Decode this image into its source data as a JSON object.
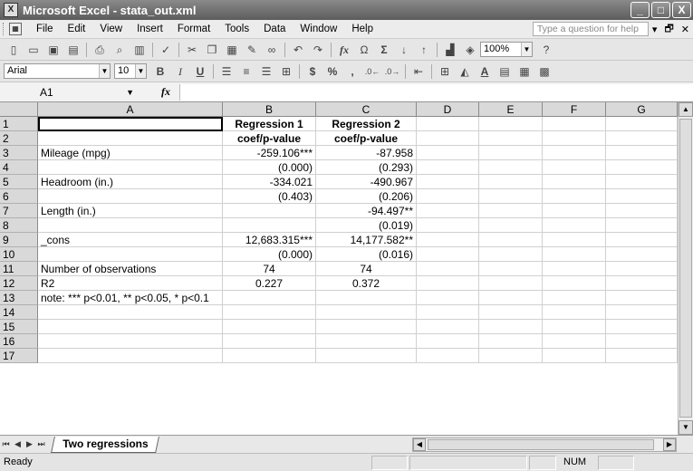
{
  "window": {
    "title": "Microsoft Excel - stata_out.xml",
    "app_icon_text": "X",
    "minimize": "_",
    "maximize": "□",
    "close": "X"
  },
  "menu": {
    "items": [
      "File",
      "Edit",
      "View",
      "Insert",
      "Format",
      "Tools",
      "Data",
      "Window",
      "Help"
    ],
    "ask_placeholder": "Type a question for help",
    "doc_icon": "▦",
    "dropdown": "▾",
    "doc_restore": "🗗",
    "doc_close": "✕"
  },
  "toolbar": {
    "font_name": "Arial",
    "font_size": "10",
    "zoom": "100%",
    "bold": "B",
    "italic": "I",
    "underline": "U",
    "currency": "$",
    "percent": "%",
    "comma": ",",
    "fx": "fx",
    "omega": "Ω",
    "sigma": "Σ"
  },
  "formula_bar": {
    "name_box": "A1",
    "fx_label": "fx",
    "content": ""
  },
  "columns": [
    "A",
    "B",
    "C",
    "D",
    "E",
    "F",
    "G"
  ],
  "rows": [
    {
      "num": "1",
      "A": "",
      "B": "Regression 1",
      "C": "Regression 2"
    },
    {
      "num": "2",
      "A": "",
      "B": "coef/p-value",
      "C": "coef/p-value"
    },
    {
      "num": "3",
      "A": "Mileage (mpg)",
      "B": "-259.106***",
      "C": "-87.958"
    },
    {
      "num": "4",
      "A": "",
      "B": "(0.000)",
      "C": "(0.293)"
    },
    {
      "num": "5",
      "A": "Headroom (in.)",
      "B": "-334.021",
      "C": "-490.967"
    },
    {
      "num": "6",
      "A": "",
      "B": "(0.403)",
      "C": "(0.206)"
    },
    {
      "num": "7",
      "A": "Length (in.)",
      "B": "",
      "C": "-94.497**"
    },
    {
      "num": "8",
      "A": "",
      "B": "",
      "C": "(0.019)"
    },
    {
      "num": "9",
      "A": "_cons",
      "B": "12,683.315***",
      "C": "14,177.582**"
    },
    {
      "num": "10",
      "A": "",
      "B": "(0.000)",
      "C": "(0.016)"
    },
    {
      "num": "11",
      "A": "Number of observations",
      "B": "74",
      "C": "74"
    },
    {
      "num": "12",
      "A": "R2",
      "B": "0.227",
      "C": "0.372"
    },
    {
      "num": "13",
      "A": "note:  *** p<0.01, ** p<0.05, * p<0.1",
      "B": "",
      "C": ""
    },
    {
      "num": "14",
      "A": "",
      "B": "",
      "C": ""
    },
    {
      "num": "15",
      "A": "",
      "B": "",
      "C": ""
    },
    {
      "num": "16",
      "A": "",
      "B": "",
      "C": ""
    },
    {
      "num": "17",
      "A": "",
      "B": "",
      "C": ""
    }
  ],
  "sheet_tabs": {
    "active": "Two regressions",
    "nav": [
      "⏮",
      "◀",
      "▶",
      "⏭"
    ]
  },
  "status": {
    "mode": "Ready",
    "num_lock": "NUM"
  }
}
